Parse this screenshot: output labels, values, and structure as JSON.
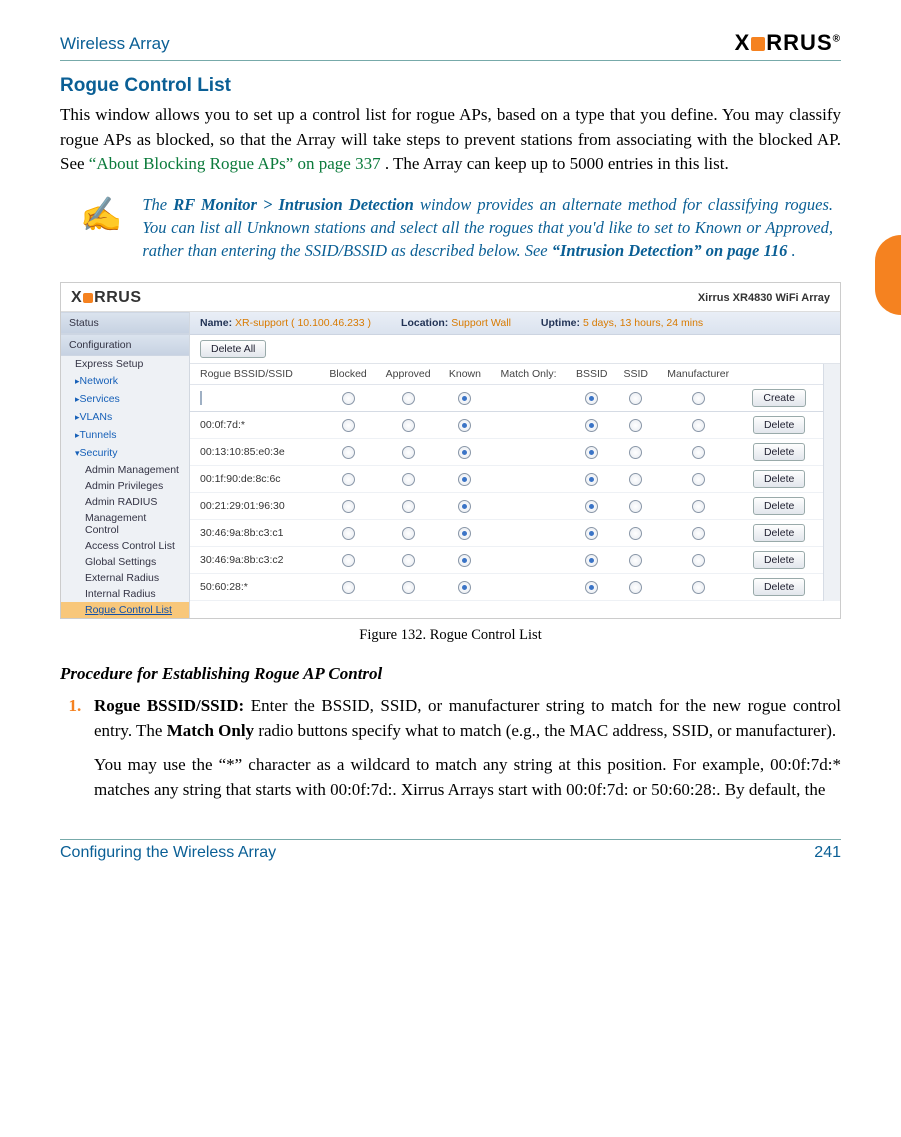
{
  "header": {
    "running_title": "Wireless Array",
    "brand": "XIRRUS"
  },
  "thumb_tab": true,
  "section_title": "Rogue Control List",
  "intro_para_pre": "This window allows you to set up a control list for rogue APs, based on a type that you define. You may classify rogue APs as blocked, so that the Array will take steps to prevent stations from associating with the blocked AP. See ",
  "intro_link": "“About Blocking Rogue APs” on page 337",
  "intro_para_post": ". The Array can keep up to 5000 entries in this list.",
  "note": {
    "icon": "✍",
    "text_pre": "The ",
    "bold1": "RF Monitor > Intrusion Detection",
    "text_mid": " window provides an alternate method for classifying rogues. You can list all Unknown stations and select all the rogues that you'd like to set to Known or Approved, rather than entering the SSID/BSSID as described below. See ",
    "bold2": "“Intrusion Detection” on page 116",
    "text_post": "."
  },
  "ui": {
    "brand": "XIRRUS",
    "model": "Xirrus XR4830 WiFi Array",
    "info": {
      "name_label": "Name:",
      "name_value": "XR-support   ( 10.100.46.233 )",
      "loc_label": "Location:",
      "loc_value": "Support Wall",
      "up_label": "Uptime:",
      "up_value": "5 days, 13 hours, 24 mins"
    },
    "nav": {
      "status": "Status",
      "config": "Configuration",
      "groups": [
        "Express Setup",
        "Network",
        "Services",
        "VLANs",
        "Tunnels",
        "Security"
      ],
      "security_children": [
        "Admin Management",
        "Admin Privileges",
        "Admin RADIUS",
        "Management Control",
        "Access Control List",
        "Global Settings",
        "External Radius",
        "Internal Radius",
        "Rogue Control List"
      ]
    },
    "toolbar": {
      "delete_all": "Delete All"
    },
    "columns": [
      "Rogue BSSID/SSID",
      "Blocked",
      "Approved",
      "Known",
      "Match Only:",
      "BSSID",
      "SSID",
      "Manufacturer",
      ""
    ],
    "create_label": "Create",
    "delete_label": "Delete",
    "rows": [
      {
        "bssid": "00:0f:7d:*",
        "sel": 2,
        "match": 0
      },
      {
        "bssid": "00:13:10:85:e0:3e",
        "sel": 2,
        "match": 0
      },
      {
        "bssid": "00:1f:90:de:8c:6c",
        "sel": 2,
        "match": 0
      },
      {
        "bssid": "00:21:29:01:96:30",
        "sel": 2,
        "match": 0
      },
      {
        "bssid": "30:46:9a:8b:c3:c1",
        "sel": 2,
        "match": 0
      },
      {
        "bssid": "30:46:9a:8b:c3:c2",
        "sel": 2,
        "match": 0
      },
      {
        "bssid": "50:60:28:*",
        "sel": 2,
        "match": 0
      }
    ]
  },
  "figure_caption": "Figure 132. Rogue Control List",
  "procedure_title": "Procedure for Establishing Rogue AP Control",
  "step1": {
    "lead": "Rogue BSSID/SSID:",
    "p1": " Enter the BSSID, SSID, or manufacturer string to match for the new rogue control entry. The ",
    "bold_mid": "Match Only",
    "p1b": " radio buttons specify what to match (e.g., the MAC address, SSID, or manufacturer).",
    "p2": "You may use the “*” character as a wildcard to match any string at this position. For example, 00:0f:7d:* matches any string that starts with 00:0f:7d:. Xirrus Arrays start with 00:0f:7d: or 50:60:28:. By default, the"
  },
  "footer": {
    "left": "Configuring the Wireless Array",
    "right": "241"
  }
}
